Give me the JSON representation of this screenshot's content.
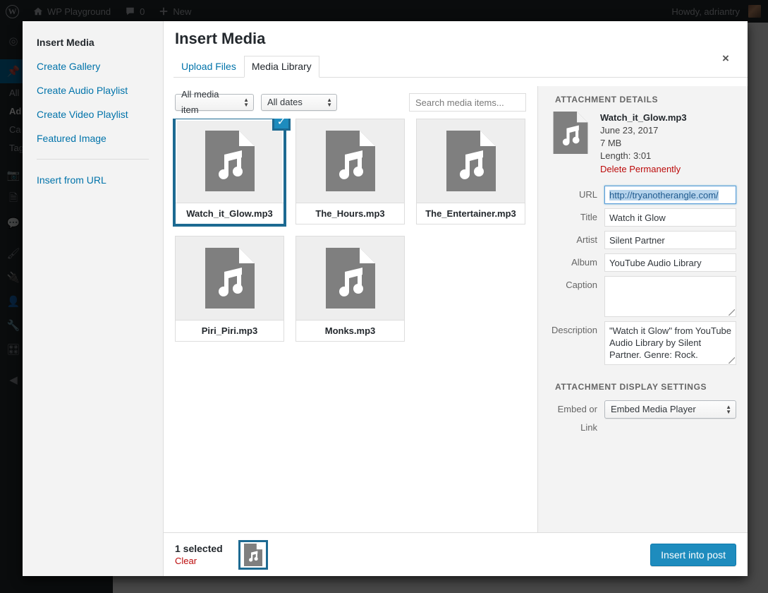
{
  "admin_bar": {
    "logo_icon": "wordpress-logo-icon",
    "site_name": "WP Playground",
    "home_icon": "home-icon",
    "comments_icon": "comment-bubble-icon",
    "comments_count": "0",
    "new_icon": "plus-icon",
    "new_label": "New",
    "howdy": "Howdy, adriantry"
  },
  "admin_menu": {
    "items": [
      {
        "icon": "dashboard-icon",
        "label": ""
      },
      {
        "icon": "pin-posts-icon",
        "label": ""
      }
    ],
    "submenu": [
      {
        "label": "All"
      },
      {
        "label": "Ad"
      },
      {
        "label": "Ca"
      },
      {
        "label": "Tag"
      }
    ],
    "lower_icons": [
      "media-camera-icon",
      "pages-icon",
      "comments-icon",
      "appearance-brush-icon",
      "plugins-plug-icon",
      "users-icon",
      "tools-wrench-icon",
      "settings-sliders-icon",
      "collapse-menu-icon"
    ]
  },
  "modal": {
    "title": "Insert Media",
    "close_label": "×",
    "menu": [
      {
        "label": "Insert Media",
        "active": true
      },
      {
        "label": "Create Gallery",
        "active": false
      },
      {
        "label": "Create Audio Playlist",
        "active": false
      },
      {
        "label": "Create Video Playlist",
        "active": false
      },
      {
        "label": "Featured Image",
        "active": false
      }
    ],
    "menu_after_divider": [
      {
        "label": "Insert from URL",
        "active": false
      }
    ],
    "tabs": [
      {
        "label": "Upload Files",
        "active": false
      },
      {
        "label": "Media Library",
        "active": true
      }
    ],
    "toolbar": {
      "media_filter": "All media item",
      "date_filter": "All dates",
      "search_placeholder": "Search media items..."
    },
    "grid": [
      {
        "filename": "Watch_it_Glow.mp3",
        "selected": true,
        "icon": "audio-file-icon"
      },
      {
        "filename": "The_Hours.mp3",
        "selected": false,
        "icon": "audio-file-icon"
      },
      {
        "filename": "The_Entertainer.mp3",
        "selected": false,
        "icon": "audio-file-icon"
      },
      {
        "filename": "Piri_Piri.mp3",
        "selected": false,
        "icon": "audio-file-icon"
      },
      {
        "filename": "Monks.mp3",
        "selected": false,
        "icon": "audio-file-icon"
      }
    ],
    "details": {
      "heading": "ATTACHMENT DETAILS",
      "thumb_icon": "audio-file-icon",
      "filename": "Watch_it_Glow.mp3",
      "date": "June 23, 2017",
      "filesize": "7 MB",
      "length": "Length: 3:01",
      "delete_label": "Delete Permanently",
      "fields": {
        "url_label": "URL",
        "url_value": "http://tryanotherangle.com/",
        "title_label": "Title",
        "title_value": "Watch it Glow",
        "artist_label": "Artist",
        "artist_value": "Silent Partner",
        "album_label": "Album",
        "album_value": "YouTube Audio Library",
        "caption_label": "Caption",
        "caption_value": "",
        "description_label": "Description",
        "description_value": "\"Watch it Glow\" from YouTube Audio Library by Silent Partner. Genre: Rock."
      }
    },
    "display_settings": {
      "heading": "ATTACHMENT DISPLAY SETTINGS",
      "embed_label": "Embed or Link",
      "embed_value": "Embed Media Player"
    },
    "footer": {
      "selected_count": "1 selected",
      "clear_label": "Clear",
      "thumb_icon": "audio-file-icon",
      "insert_label": "Insert into post"
    }
  },
  "colors": {
    "accent_blue": "#1e8cbe",
    "selection_border": "#1d6a92",
    "link_blue": "#0073aa",
    "danger_red": "#bc0b0b",
    "admin_dark": "#23282d"
  }
}
